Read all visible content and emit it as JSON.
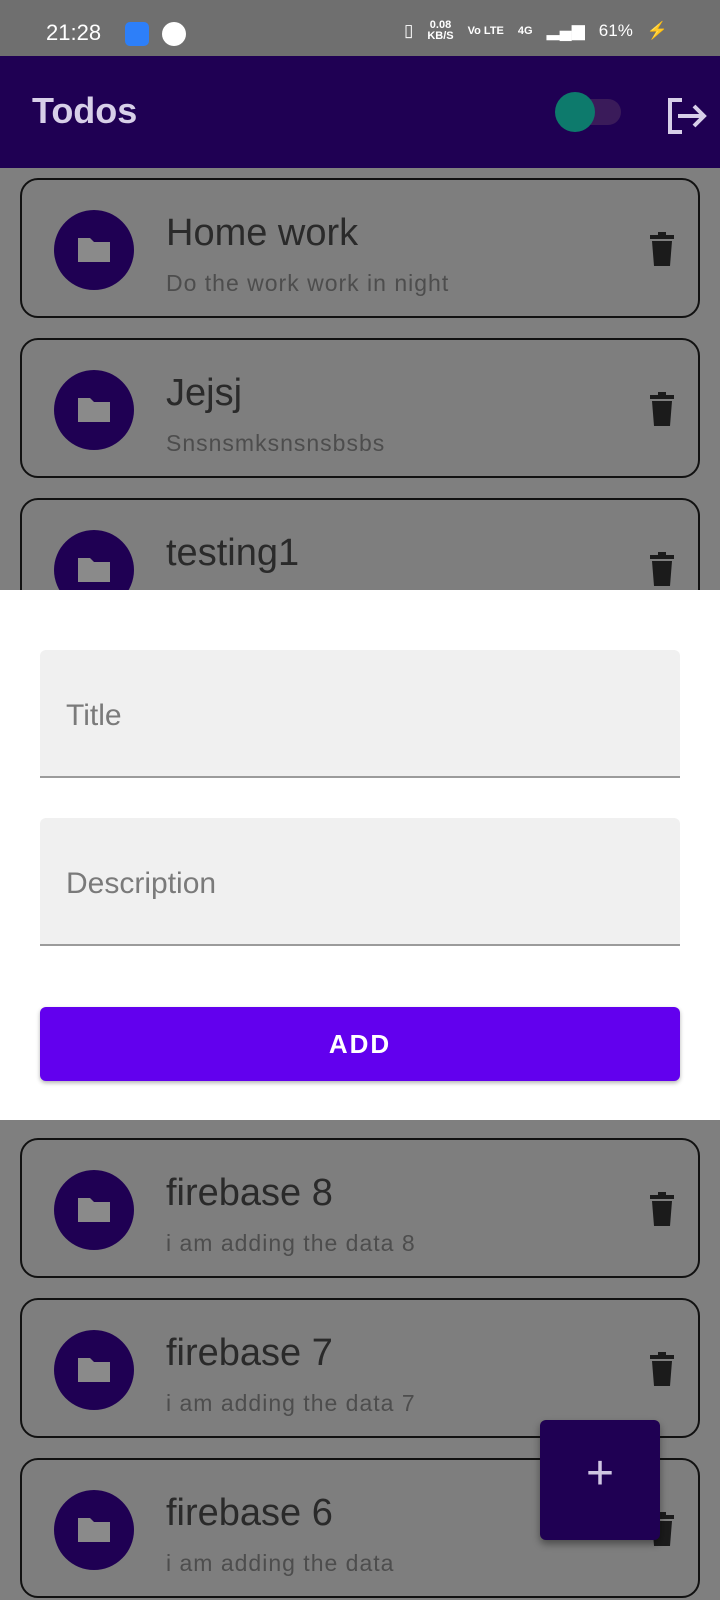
{
  "status_bar": {
    "time": "21:28",
    "speed": "0.08",
    "speed_unit": "KB/S",
    "volte": "Vo LTE",
    "network": "4G",
    "battery": "61%"
  },
  "app_bar": {
    "title": "Todos"
  },
  "todos": [
    {
      "title": "Home work",
      "description": "Do the work work in night"
    },
    {
      "title": "Jejsj",
      "description": "Snsnsmksnsnsbsbs"
    },
    {
      "title": "testing1",
      "description": ""
    },
    {
      "title": "firebase 8",
      "description": "i am adding the data 8"
    },
    {
      "title": "firebase 7",
      "description": "i am adding the data 7"
    },
    {
      "title": "firebase 6",
      "description": "i am adding the data"
    }
  ],
  "sheet": {
    "title_placeholder": "Title",
    "description_placeholder": "Description",
    "add_label": "ADD"
  },
  "fab": {
    "label": "+"
  },
  "colors": {
    "primary_dark": "#1f0053",
    "accent": "#6200ee",
    "toggle": "#0d7a6c"
  }
}
